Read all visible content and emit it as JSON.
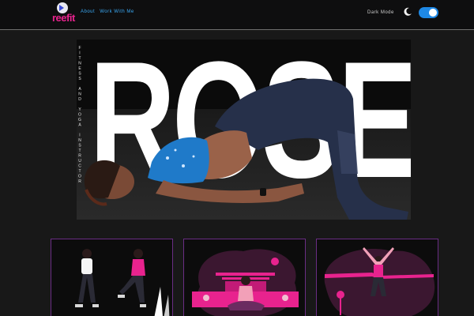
{
  "header": {
    "logo_text": "reefit",
    "nav": [
      "About",
      "Work With Me"
    ],
    "dark_mode_label": "Dark Mode",
    "dark_mode_on": true
  },
  "hero": {
    "title": "ROSE",
    "subtitle": "FITNESS AND YOGA INSTRUCTOR"
  },
  "cards": [
    {
      "illustration": "two-people-workout-illustration"
    },
    {
      "illustration": "meditation-illustration"
    },
    {
      "illustration": "finish-line-runner-illustration"
    }
  ],
  "colors": {
    "accent_pink": "#e8238e",
    "accent_blue": "#1e88e5",
    "card_border": "#6a2d84"
  }
}
